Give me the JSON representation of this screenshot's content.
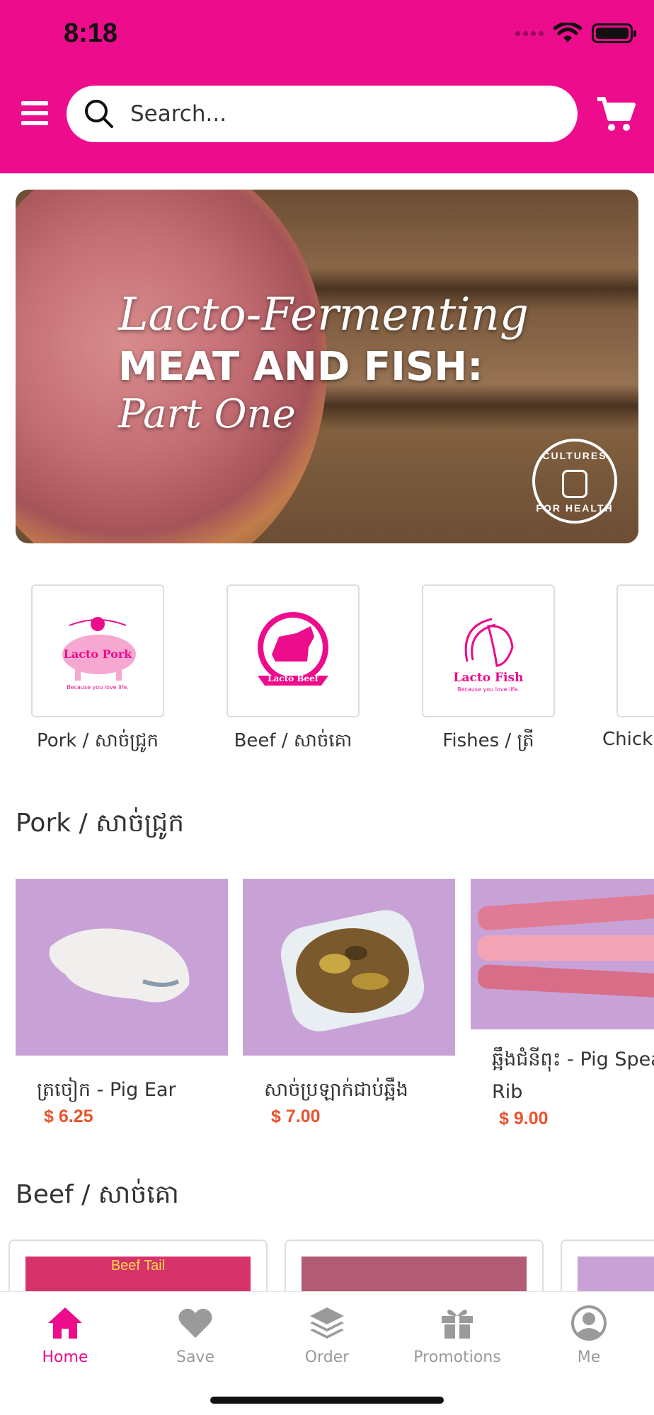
{
  "status_bar": {
    "time": "8:18"
  },
  "header": {
    "search_placeholder": "Search...",
    "accent": "#ec0c8c"
  },
  "banner": {
    "line1": "Lacto-Fermenting",
    "line2": "MEAT AND FISH:",
    "line3": "Part One",
    "seal_top": "CULTURES",
    "seal_bottom": "FOR HEALTH"
  },
  "categories": [
    {
      "logo": "Lacto Pork",
      "tagline": "Because you love life.",
      "label": "Pork / សាច់ជ្រូក"
    },
    {
      "logo": "Lacto Beef",
      "tagline": "Because you love life.",
      "label": "Beef / សាច់គោ"
    },
    {
      "logo": "Lacto Fish",
      "tagline": "Because you love life.",
      "label": "Fishes / ត្រី"
    },
    {
      "logo": "",
      "tagline": "",
      "label": "Chick"
    }
  ],
  "sections": {
    "pork_title": "Pork / សាច់ជ្រូក",
    "beef_title": "Beef / សាច់គោ"
  },
  "pork_products": [
    {
      "name": "ត្រចៀក - Pig Ear",
      "price": "$ 6.25"
    },
    {
      "name": "សាច់ប្រឡាក់ជាប់ឆ្អឹង",
      "price": "$ 7.00"
    },
    {
      "name": "ឆ្អឹងជំនីពុះ - Pig Spear Rib",
      "price": "$ 9.00"
    }
  ],
  "beef_products": [
    {
      "banner": "Beef Tail"
    }
  ],
  "tabs": [
    {
      "label": "Home",
      "icon": "home-icon",
      "active": true
    },
    {
      "label": "Save",
      "icon": "heart-icon",
      "active": false
    },
    {
      "label": "Order",
      "icon": "layers-icon",
      "active": false
    },
    {
      "label": "Promotions",
      "icon": "gift-icon",
      "active": false
    },
    {
      "label": "Me",
      "icon": "user-icon",
      "active": false
    }
  ],
  "colors": {
    "price": "#e8542f",
    "product_bg": "#c8a2d6",
    "tab_inactive": "#9a9a9a"
  }
}
